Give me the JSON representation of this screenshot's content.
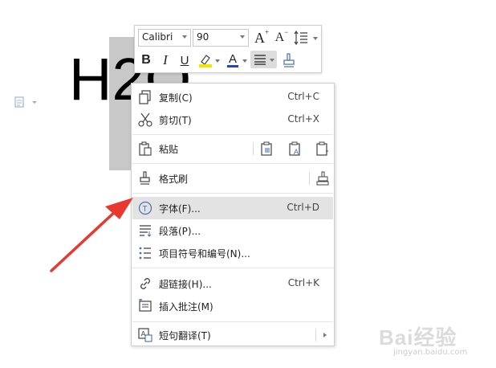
{
  "document": {
    "text": "H2O"
  },
  "mini_toolbar": {
    "font_name": "Calibri",
    "font_size": "90",
    "grow_font": "A",
    "shrink_font": "A",
    "bold": "B",
    "italic": "I",
    "underline": "U",
    "font_color": "A",
    "highlight_color": "#f5e600",
    "font_color_value": "#1f3fd6"
  },
  "context_menu": {
    "items": [
      {
        "label": "复制(C)",
        "shortcut": "Ctrl+C",
        "icon": "copy-icon"
      },
      {
        "label": "剪切(T)",
        "shortcut": "Ctrl+X",
        "icon": "cut-icon"
      },
      {
        "label": "粘贴",
        "shortcut": "",
        "icon": "paste-icon"
      },
      {
        "label": "格式刷",
        "shortcut": "",
        "icon": "format-painter-icon"
      },
      {
        "label": "字体(F)...",
        "shortcut": "Ctrl+D",
        "icon": "font-icon"
      },
      {
        "label": "段落(P)...",
        "shortcut": "",
        "icon": "paragraph-icon"
      },
      {
        "label": "项目符号和编号(N)...",
        "shortcut": "",
        "icon": "bullets-icon"
      },
      {
        "label": "超链接(H)...",
        "shortcut": "Ctrl+K",
        "icon": "hyperlink-icon"
      },
      {
        "label": "插入批注(M)",
        "shortcut": "",
        "icon": "comment-icon"
      },
      {
        "label": "短句翻译(T)",
        "shortcut": "",
        "icon": "translate-icon"
      }
    ],
    "highlighted_index": 4
  },
  "watermark": {
    "brand": "Bai经验",
    "url": "jingyan.baidu.com"
  },
  "colors": {
    "arrow": "#e8382f",
    "highlight_row": "#e3e3e3"
  }
}
